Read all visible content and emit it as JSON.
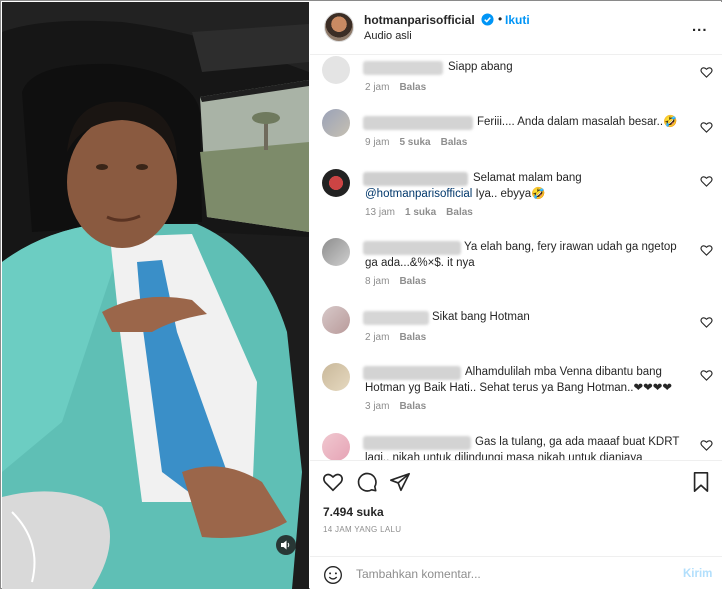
{
  "post": {
    "username": "hotmanparisofficial",
    "dot": "•",
    "follow_label": "Ikuti",
    "audio_label": "Audio asli",
    "more_label": "..."
  },
  "comments": [
    {
      "text": "Siapp abang",
      "time": "2 jam",
      "likes": "",
      "reply": "Balas"
    },
    {
      "text": "Feriii.... Anda dalam masalah besar..🤣",
      "time": "9 jam",
      "likes": "5 suka",
      "reply": "Balas"
    },
    {
      "text_line1": "Selamat malam bang",
      "mention": "@hotmanparisofficial",
      "text_line2": " Iya.. ebyya🤣",
      "time": "13 jam",
      "likes": "1 suka",
      "reply": "Balas"
    },
    {
      "text_line1": "Ya elah bang, fery irawan udah ga ngetop",
      "text_line2": "ga ada...&%×$. it nya",
      "time": "8 jam",
      "likes": "",
      "reply": "Balas"
    },
    {
      "text": "Sikat bang Hotman",
      "time": "2 jam",
      "likes": "",
      "reply": "Balas"
    },
    {
      "text_line1": "Alhamdulilah mba Venna dibantu bang",
      "text_line2": "Hotman yg Baik Hati.. Sehat terus ya Bang Hotman..❤❤❤❤",
      "time": "3 jam",
      "likes": "",
      "reply": "Balas"
    },
    {
      "text_line1": "Gas la tulang, ga ada maaaf buat KDRT",
      "text_line2": "lagi.. nikah untuk dilindungi masa nikah untuk dianiaya",
      "time": "",
      "likes": "",
      "reply": ""
    }
  ],
  "stats": {
    "likes": "7.494 suka",
    "time_ago": "14 JAM YANG LALU"
  },
  "composer": {
    "placeholder": "Tambahkan komentar...",
    "post_label": "Kirim"
  },
  "colors": {
    "accent": "#0095f6",
    "suit": "#5fbfb5",
    "tie": "#3a8fc8"
  },
  "icons": [
    "verified-badge-icon",
    "more-options-icon",
    "heart-icon",
    "comment-icon",
    "share-icon",
    "bookmark-icon",
    "emoji-icon",
    "speaker-icon"
  ]
}
